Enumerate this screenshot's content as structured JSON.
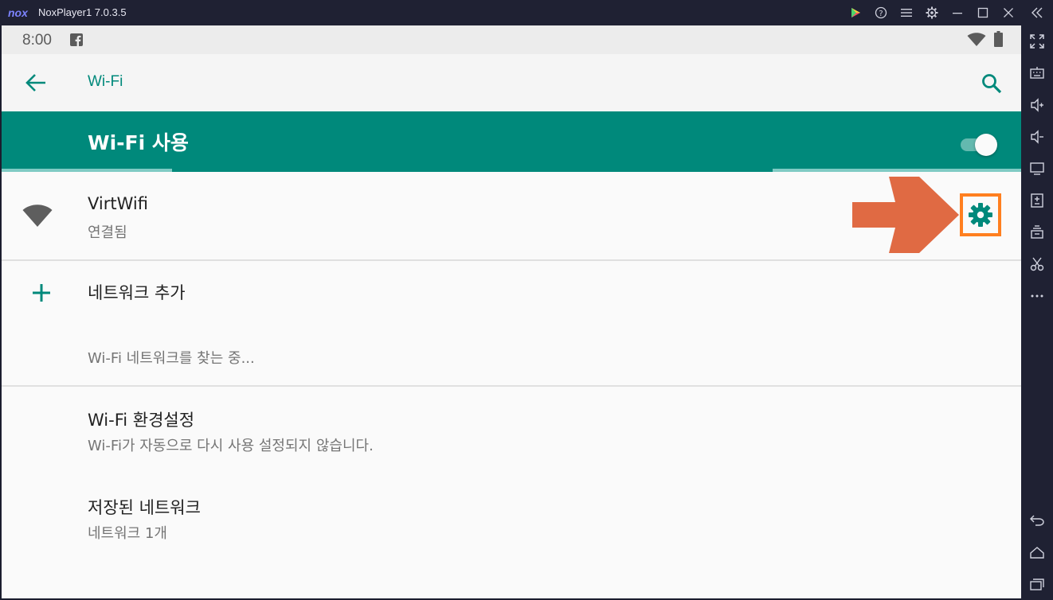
{
  "window": {
    "title": "NoxPlayer1  7.0.3.5",
    "logo_text": "nox"
  },
  "titlebar_controls": [
    {
      "name": "play-store-icon"
    },
    {
      "name": "help-icon"
    },
    {
      "name": "menu-icon"
    },
    {
      "name": "settings-icon"
    },
    {
      "name": "minimize-icon"
    },
    {
      "name": "maximize-icon"
    },
    {
      "name": "close-icon"
    },
    {
      "name": "collapse-sidebar-icon"
    }
  ],
  "statusbar": {
    "time": "8:00"
  },
  "appbar": {
    "title": "Wi-Fi"
  },
  "master_switch": {
    "label": "Wi-Fi 사용",
    "enabled": true
  },
  "networks": [
    {
      "ssid": "VirtWifi",
      "status": "연결됨"
    }
  ],
  "add_network": {
    "label": "네트워크 추가"
  },
  "scanning_text": "Wi-Fi 네트워크를 찾는 중...",
  "preferences": {
    "title": "Wi-Fi 환경설정",
    "summary": "Wi-Fi가 자동으로 다시 사용 설정되지 않습니다."
  },
  "saved_networks": {
    "title": "저장된 네트워크",
    "summary": "네트워크 1개"
  },
  "colors": {
    "accent": "#00897b",
    "highlight_box": "#ff7f1f",
    "arrow": "#e06a43"
  }
}
